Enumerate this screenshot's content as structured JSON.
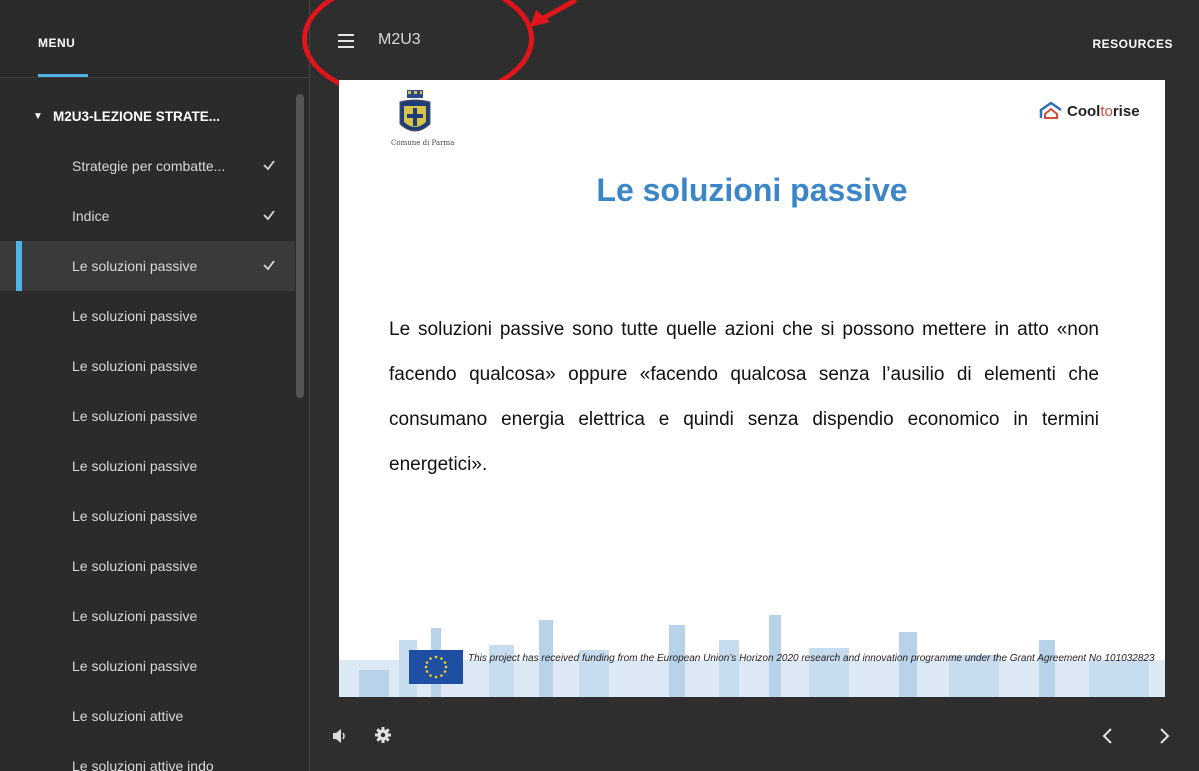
{
  "sidebar": {
    "menu_label": "MENU",
    "section_title": "M2U3-LEZIONE STRATE...",
    "lessons": [
      {
        "label": "Strategie per combatte...",
        "completed": true,
        "active": false
      },
      {
        "label": "Indice",
        "completed": true,
        "active": false
      },
      {
        "label": "Le soluzioni passive",
        "completed": true,
        "active": true
      },
      {
        "label": "Le soluzioni passive",
        "completed": false,
        "active": false
      },
      {
        "label": "Le soluzioni passive",
        "completed": false,
        "active": false
      },
      {
        "label": "Le soluzioni passive",
        "completed": false,
        "active": false
      },
      {
        "label": "Le soluzioni passive",
        "completed": false,
        "active": false
      },
      {
        "label": "Le soluzioni passive",
        "completed": false,
        "active": false
      },
      {
        "label": "Le soluzioni passive",
        "completed": false,
        "active": false
      },
      {
        "label": "Le soluzioni passive",
        "completed": false,
        "active": false
      },
      {
        "label": "Le soluzioni passive",
        "completed": false,
        "active": false
      },
      {
        "label": "Le soluzioni attive",
        "completed": false,
        "active": false
      },
      {
        "label": "Le soluzioni attive indo",
        "completed": false,
        "active": false
      }
    ]
  },
  "topbar": {
    "course_title": "M2U3",
    "resources_label": "RESOURCES"
  },
  "slide": {
    "logo_left_caption": "Comune di Parma",
    "logo_right_text_part1": "Cool",
    "logo_right_text_part2": "to",
    "logo_right_text_part3": "rise",
    "title": "Le soluzioni passive",
    "body": "Le soluzioni passive sono tutte quelle azioni che si possono mettere in atto «non facendo qualcosa» oppure «facendo qualcosa senza l’ausilio di elementi che consumano energia elettrica e quindi senza dispendio economico in termini energetici».",
    "funding_text": "This project has received funding from the European Union’s Horizon 2020 research and innovation programme under the Grant Agreement No 101032823"
  },
  "colors": {
    "accent": "#4fb3e3",
    "slide_title": "#3a86c6",
    "annotation": "#e0151c"
  }
}
